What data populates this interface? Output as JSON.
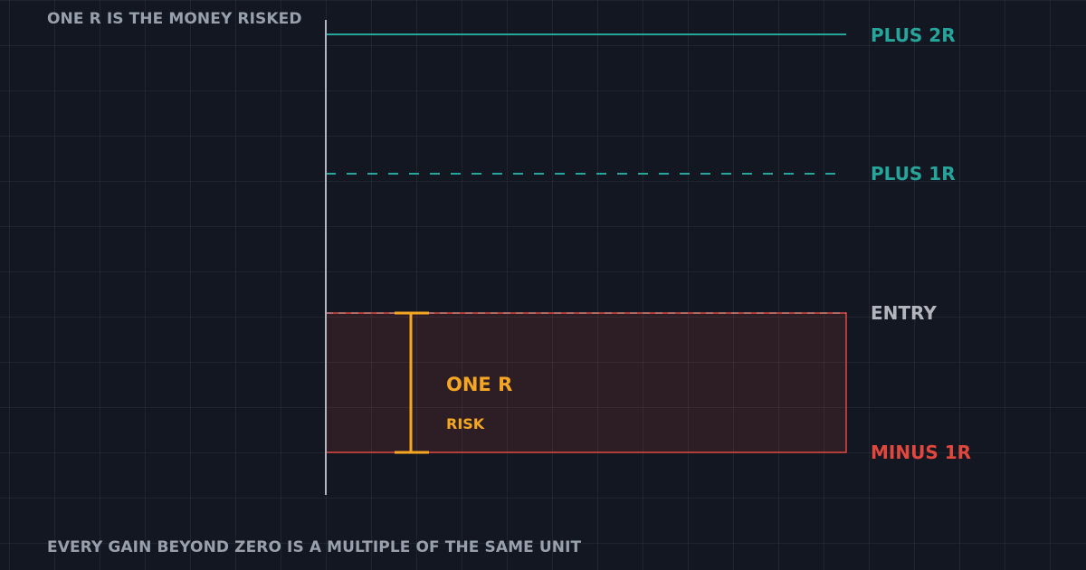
{
  "captions": {
    "top": "ONE R IS THE MONEY RISKED",
    "bottom": "EVERY GAIN BEYOND ZERO IS A MULTIPLE OF THE SAME UNIT"
  },
  "levels": [
    {
      "key": "plus2r",
      "label": "PLUS 2R",
      "value": 2,
      "style": "solid",
      "color": "#26a69a"
    },
    {
      "key": "plus1r",
      "label": "PLUS 1R",
      "value": 1,
      "style": "dashed",
      "color": "#26a69a"
    },
    {
      "key": "entry",
      "label": "ENTRY",
      "value": 0,
      "style": "dashed",
      "color": "#b2b5be"
    },
    {
      "key": "minus1r",
      "label": "MINUS 1R",
      "value": -1,
      "style": "solid",
      "color": "#e0483e"
    }
  ],
  "risk_box": {
    "title": "ONE R",
    "subtitle": "RISK",
    "accent_color": "#f5a623"
  },
  "colors": {
    "background": "#131722",
    "axis": "#b2b5be",
    "label_gray": "#9aa0ab"
  }
}
